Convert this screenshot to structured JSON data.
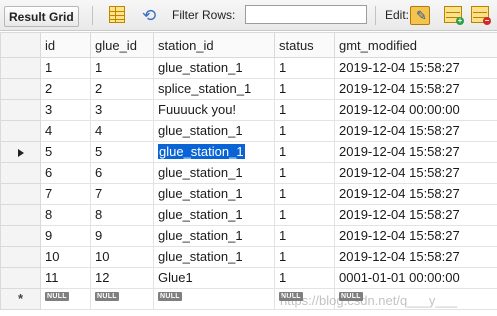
{
  "toolbar": {
    "result_grid_label": "Result Grid",
    "filter_label": "Filter Rows:",
    "filter_value": "",
    "edit_label": "Edit:"
  },
  "grid": {
    "columns": [
      "id",
      "glue_id",
      "station_id",
      "status",
      "gmt_modified"
    ],
    "rows": [
      [
        "1",
        "1",
        "glue_station_1",
        "1",
        "2019-12-04 15:58:27"
      ],
      [
        "2",
        "2",
        "splice_station_1",
        "1",
        "2019-12-04 15:58:27"
      ],
      [
        "3",
        "3",
        "Fuuuuck you!",
        "1",
        "2019-12-04 00:00:00"
      ],
      [
        "4",
        "4",
        "glue_station_1",
        "1",
        "2019-12-04 15:58:27"
      ],
      [
        "5",
        "5",
        "glue_station_1",
        "1",
        "2019-12-04 15:58:27"
      ],
      [
        "6",
        "6",
        "glue_station_1",
        "1",
        "2019-12-04 15:58:27"
      ],
      [
        "7",
        "7",
        "glue_station_1",
        "1",
        "2019-12-04 15:58:27"
      ],
      [
        "8",
        "8",
        "glue_station_1",
        "1",
        "2019-12-04 15:58:27"
      ],
      [
        "9",
        "9",
        "glue_station_1",
        "1",
        "2019-12-04 15:58:27"
      ],
      [
        "10",
        "10",
        "glue_station_1",
        "1",
        "2019-12-04 15:58:27"
      ],
      [
        "11",
        "12",
        "Glue1",
        "1",
        "0001-01-01 00:00:00"
      ]
    ],
    "null_label": "NULL",
    "new_row_marker": "*"
  },
  "watermark": "https://blog.csdn.net/q___y___",
  "colors": {
    "selection": "#0a64d6",
    "toolbar_bg": "#ececec"
  },
  "icons": {
    "grid": "form-grid-icon",
    "refresh": "refresh-icon",
    "edit": "edit-pencil-icon",
    "add_row": "add-row-icon",
    "delete_row": "delete-row-icon"
  }
}
